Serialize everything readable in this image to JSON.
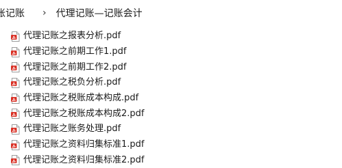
{
  "breadcrumb": {
    "items": [
      "账记账",
      "代理记账—记账会计"
    ],
    "separator": "›"
  },
  "files": [
    {
      "name": "代理记账之报表分析.pdf",
      "icon": "pdf-icon"
    },
    {
      "name": "代理记账之前期工作1.pdf",
      "icon": "pdf-icon"
    },
    {
      "name": "代理记账之前期工作2.pdf",
      "icon": "pdf-icon"
    },
    {
      "name": "代理记账之税负分析.pdf",
      "icon": "pdf-icon"
    },
    {
      "name": "代理记账之税账成本构成.pdf",
      "icon": "pdf-icon"
    },
    {
      "name": "代理记账之税账成本构成2.pdf",
      "icon": "pdf-icon"
    },
    {
      "name": "代理记账之账务处理.pdf",
      "icon": "pdf-icon"
    },
    {
      "name": "代理记账之资料归集标准1.pdf",
      "icon": "pdf-icon"
    },
    {
      "name": "代理记账之资料归集标准2.pdf",
      "icon": "pdf-icon"
    }
  ],
  "colors": {
    "pdf_red": "#d93025",
    "text": "#1a1a1a",
    "background": "#ffffff"
  }
}
